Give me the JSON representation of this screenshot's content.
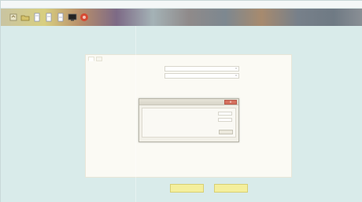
{
  "menubar": {
    "items": [
      "",
      "",
      "",
      ""
    ]
  },
  "toolbar": {
    "buttons": [
      {
        "icon": "tool-icon"
      },
      {
        "icon": "folder-icon"
      },
      {
        "icon": "document-icon"
      },
      {
        "icon": "document-icon"
      },
      {
        "icon": "document-icon"
      },
      {
        "icon": "monitor-icon"
      },
      {
        "icon": "stop-icon"
      }
    ]
  },
  "tabs": [
    {
      "label": ""
    },
    {
      "label": ""
    }
  ],
  "form": {
    "row1_label": "",
    "row1_value": "",
    "row2_label": "",
    "row2_value": ""
  },
  "dialog": {
    "title": "",
    "close_label": "×",
    "text": "",
    "button_label": ""
  },
  "footer": {
    "left_button": "",
    "right_button": ""
  },
  "colors": {
    "workspace": "#d9ebea",
    "panel": "#fbfaf4",
    "button": "#f4ef9d",
    "close": "#d6715f"
  }
}
